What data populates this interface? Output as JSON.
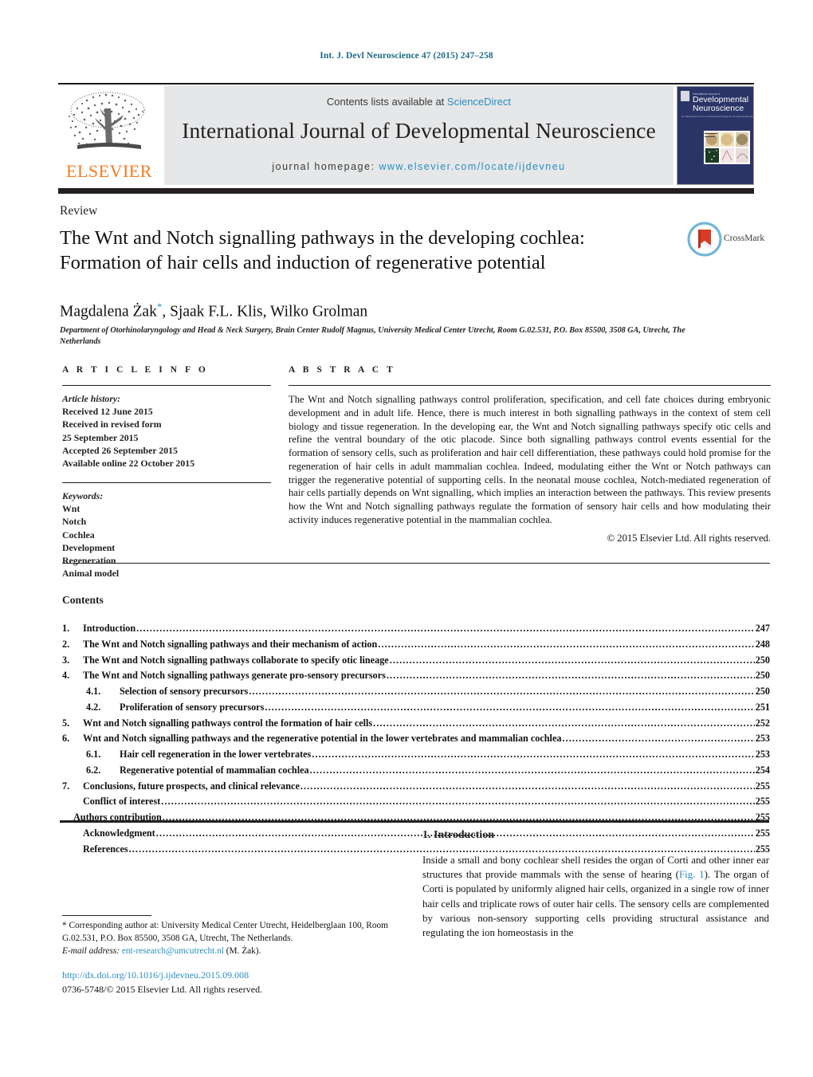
{
  "running_head": "Int. J. Devl Neuroscience 47 (2015) 247–258",
  "masthead": {
    "contents_prefix": "Contents lists available at ",
    "sciencedirect": "ScienceDirect",
    "journal_title": "International Journal of Developmental Neuroscience",
    "homepage_prefix": "journal homepage: ",
    "homepage_url": "www.elsevier.com/locate/ijdevneu",
    "publisher": "ELSEVIER",
    "cover_line1": "Developmental",
    "cover_line2": "Neuroscience",
    "cover_kicker": "International Journal of"
  },
  "article": {
    "doctype": "Review",
    "title_line1": "The Wnt and Notch signalling pathways in the developing cochlea:",
    "title_line2": "Formation of hair cells and induction of regenerative potential",
    "authors": "Magdalena Żak",
    "authors_rest": ", Sjaak F.L. Klis, Wilko Grolman",
    "corresponding_marker": "*",
    "affiliation": "Department of Otorhinolaryngology and Head & Neck Surgery, Brain Center Rudolf Magnus, University Medical Center Utrecht, Room G.02.531, P.O. Box 85500, 3508 GA, Utrecht, The Netherlands",
    "crossmark_label": "CrossMark"
  },
  "info": {
    "heading": "A R T I C L E    I N F O",
    "history_label": "Article history:",
    "history": [
      "Received 12 June 2015",
      "Received in revised form",
      "25 September 2015",
      "Accepted 26 September 2015",
      "Available online 22 October 2015"
    ],
    "keywords_label": "Keywords:",
    "keywords": [
      "Wnt",
      "Notch",
      "Cochlea",
      "Development",
      "Regeneration",
      "Animal model"
    ]
  },
  "abstract": {
    "heading": "A B S T R A C T",
    "text": "The Wnt and Notch signalling pathways control proliferation, specification, and cell fate choices during embryonic development and in adult life. Hence, there is much interest in both signalling pathways in the context of stem cell biology and tissue regeneration. In the developing ear, the Wnt and Notch signalling pathways specify otic cells and refine the ventral boundary of the otic placode. Since both signalling pathways control events essential for the formation of sensory cells, such as proliferation and hair cell differentiation, these pathways could hold promise for the regeneration of hair cells in adult mammalian cochlea. Indeed, modulating either the Wnt or Notch pathways can trigger the regenerative potential of supporting cells. In the neonatal mouse cochlea, Notch-mediated regeneration of hair cells partially depends on Wnt signalling, which implies an interaction between the pathways. This review presents how the Wnt and Notch signalling pathways regulate the formation of sensory hair cells and how modulating their activity induces regenerative potential in the mammalian cochlea.",
    "copyright": "© 2015 Elsevier Ltd. All rights reserved."
  },
  "contents": {
    "heading": "Contents",
    "entries": [
      {
        "level": 1,
        "num": "1.",
        "label": "Introduction",
        "page": "247"
      },
      {
        "level": 1,
        "num": "2.",
        "label": "The Wnt and Notch signalling pathways and their mechanism of action",
        "page": "248"
      },
      {
        "level": 1,
        "num": "3.",
        "label": "The Wnt and Notch signalling pathways collaborate to specify otic lineage",
        "page": "250"
      },
      {
        "level": 1,
        "num": "4.",
        "label": "The Wnt and Notch signalling pathways generate pro-sensory precursors",
        "page": "250"
      },
      {
        "level": 2,
        "num": "4.1.",
        "label": "Selection of sensory precursors",
        "page": "250"
      },
      {
        "level": 2,
        "num": "4.2.",
        "label": "Proliferation of sensory precursors",
        "page": "251"
      },
      {
        "level": 1,
        "num": "5.",
        "label": "Wnt and Notch signalling pathways control the formation of hair cells",
        "page": "252"
      },
      {
        "level": 1,
        "num": "6.",
        "label": "Wnt and Notch signalling pathways and the regenerative potential in the lower vertebrates and mammalian cochlea",
        "page": "253"
      },
      {
        "level": 2,
        "num": "6.1.",
        "label": "Hair cell regeneration in the lower vertebrates",
        "page": "253"
      },
      {
        "level": 2,
        "num": "6.2.",
        "label": "Regenerative potential of mammalian cochlea",
        "page": "254"
      },
      {
        "level": 1,
        "num": "7.",
        "label": "Conclusions, future prospects, and clinical relevance",
        "page": "255"
      },
      {
        "level": 3,
        "num": "",
        "label": "Conflict of interest",
        "page": "255"
      },
      {
        "level": 4,
        "num": "",
        "label": "Authors contribution",
        "page": "255"
      },
      {
        "level": 3,
        "num": "",
        "label": "Acknowledgment",
        "page": "255"
      },
      {
        "level": 3,
        "num": "",
        "label": "References",
        "page": "255"
      }
    ]
  },
  "introduction": {
    "heading": "1. Introduction",
    "para_a": "Inside a small and bony cochlear shell resides the organ of Corti and other inner ear structures that provide mammals with the sense of hearing (",
    "figlink": "Fig. 1",
    "para_b": "). The organ of Corti is populated by uniformly aligned hair cells, organized in a single row of inner hair cells and triplicate rows of outer hair cells. The sensory cells are complemented by various non-sensory supporting cells providing structural assistance and regulating the ion homeostasis in the"
  },
  "footnote": {
    "marker": "*",
    "corresponding": "Corresponding author at: University Medical Center Utrecht, Heidelberglaan 100, Room G.02.531, P.O. Box 85500, 3508 GA, Utrecht, The Netherlands.",
    "email_label": "E-mail address:",
    "email": "ent-research@umcutrecht.nl",
    "email_owner": "(M. Żak).",
    "doi": "http://dx.doi.org/10.1016/j.ijdevneu.2015.09.008",
    "issn_line": "0736-5748/© 2015 Elsevier Ltd. All rights reserved."
  },
  "colors": {
    "link": "#2a8ec4",
    "runhead": "#1d6b8a",
    "elsevier_orange": "#f47b20",
    "band_grey": "#e6e7e8",
    "cover_navy": "#2b3466"
  }
}
